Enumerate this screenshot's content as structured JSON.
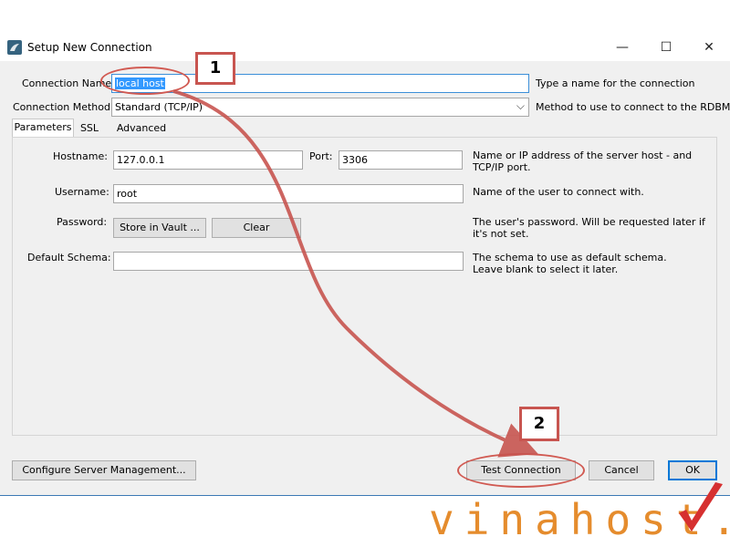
{
  "window": {
    "title": "Setup New Connection",
    "icon": "mysql-dolphin-icon",
    "controls": {
      "minimize": "—",
      "maximize": "☐",
      "close": "✕"
    }
  },
  "connection_name": {
    "label": "Connection Name:",
    "value": "local host",
    "help": "Type a name for the connection"
  },
  "connection_method": {
    "label": "Connection Method:",
    "value": "Standard (TCP/IP)",
    "help": "Method to use to connect to the RDBMS"
  },
  "tabs": [
    {
      "label": "Parameters",
      "active": true
    },
    {
      "label": "SSL",
      "active": false
    },
    {
      "label": "Advanced",
      "active": false
    }
  ],
  "parameters": {
    "hostname": {
      "label": "Hostname:",
      "value": "127.0.0.1"
    },
    "port": {
      "label": "Port:",
      "value": "3306"
    },
    "host_help": "Name or IP address of the server host - and TCP/IP port.",
    "username": {
      "label": "Username:",
      "value": "root",
      "help": "Name of the user to connect with."
    },
    "password": {
      "label": "Password:",
      "store_button": "Store in Vault ...",
      "clear_button": "Clear",
      "help": "The user's password. Will be requested later if it's not set."
    },
    "default_schema": {
      "label": "Default Schema:",
      "value": "",
      "help": "The schema to use as default schema. Leave blank to select it later."
    }
  },
  "footer": {
    "configure_button": "Configure Server Management...",
    "test_button": "Test Connection",
    "cancel_button": "Cancel",
    "ok_button": "OK"
  },
  "annotations": {
    "step1": "1",
    "step2": "2",
    "color": "#c85550"
  },
  "watermark": {
    "text": "vinahost.",
    "color": "#e58c2d",
    "check_color": "#d63030"
  }
}
